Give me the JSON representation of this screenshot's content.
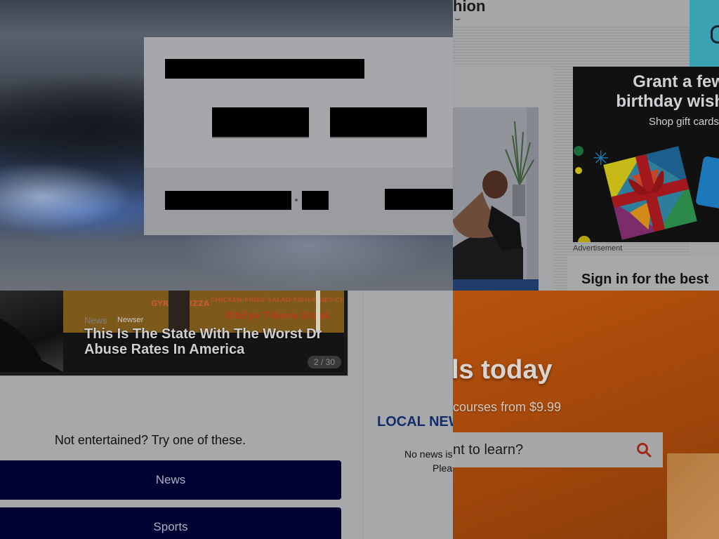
{
  "amazon": {
    "logo_partial": "hion",
    "ad_title": "Grant a few birthday wishes",
    "ad_title_line1": "Grant a few",
    "ad_title_line2": "birthday wish",
    "ad_sub": "Shop gift cards",
    "ad_label": "Advertisement",
    "signin": "Sign in for the best"
  },
  "news": {
    "slide": {
      "category": "News",
      "source": "Newser",
      "title": "This Is The State With The Worst Drug Abuse Rates In America",
      "title_line1": "This Is The State With The Worst Dr",
      "title_line2": "Abuse Rates In America",
      "counter": "2 / 30"
    },
    "try_heading": "Not entertained? Try one of these.",
    "buttons": [
      "News",
      "Sports"
    ],
    "local_news": {
      "heading": "LOCAL NEWS",
      "line1": "No news is",
      "line2": "Pleas"
    }
  },
  "course": {
    "headline": "ls today",
    "subline": "courses from $9.99",
    "search_placeholder": "nt to learn?"
  },
  "colors": {
    "modal_bg": "#a5a7aa",
    "button_navy": "#000033",
    "local_news_blue": "#142c6a",
    "course_orange": "#b8530f",
    "ad_teal": "#3aa2b0"
  }
}
